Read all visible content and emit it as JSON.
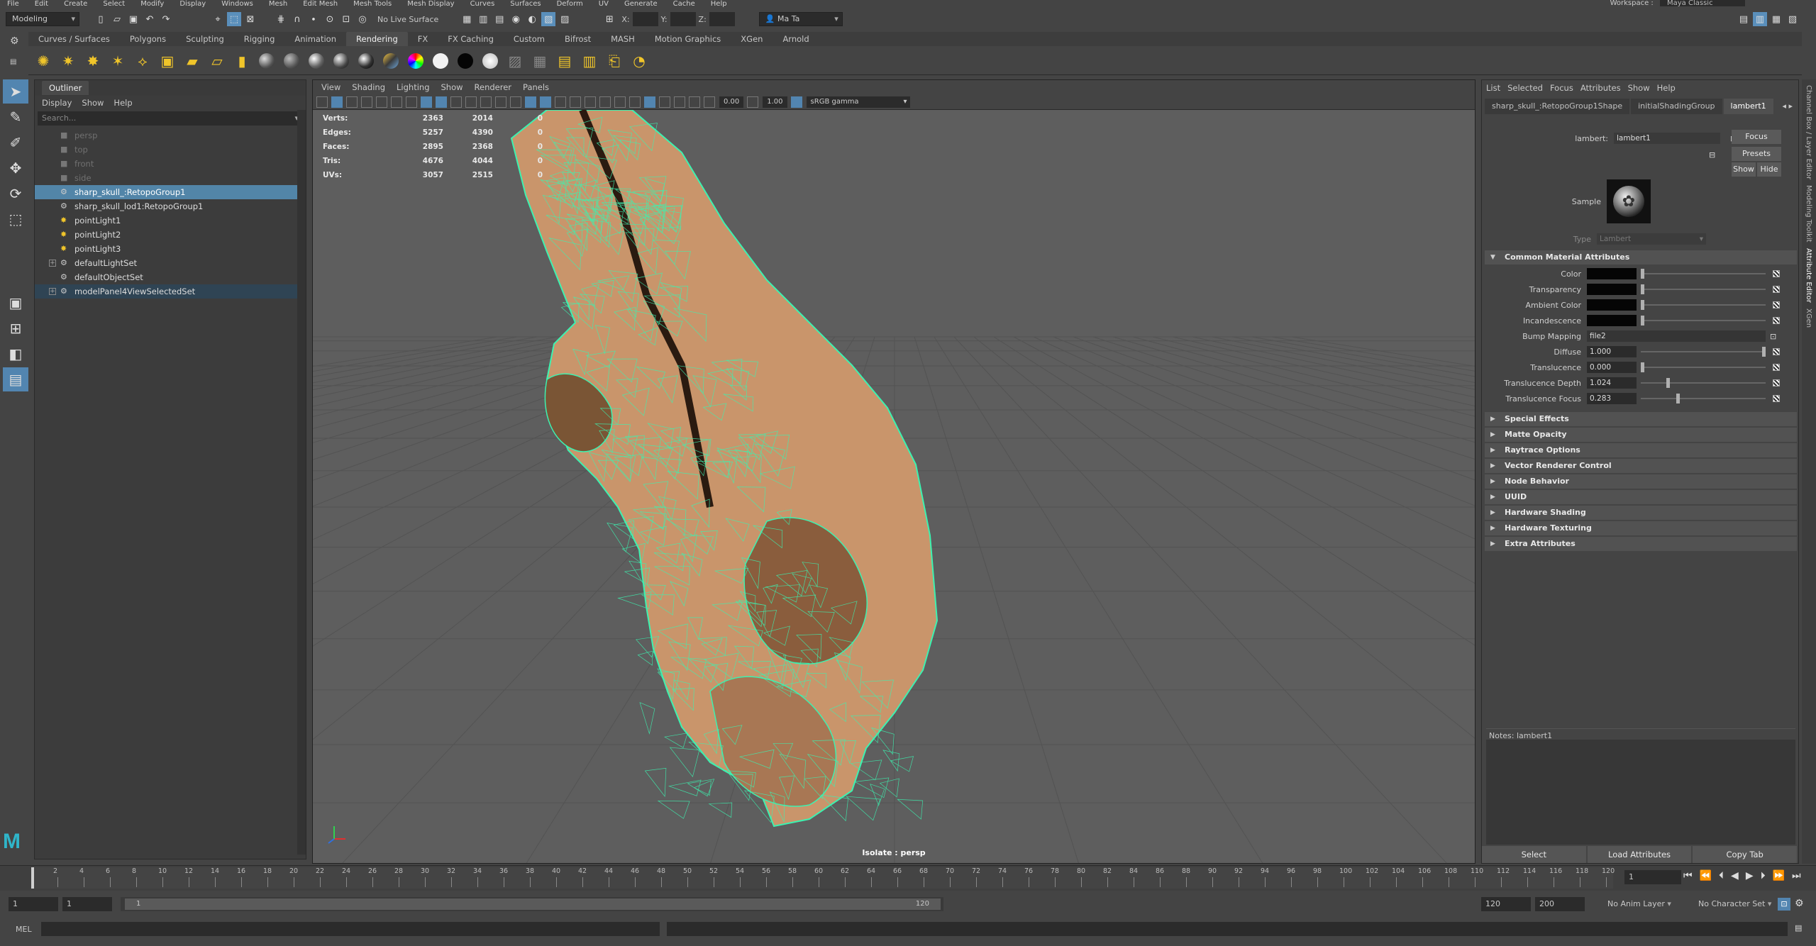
{
  "menubar": [
    "File",
    "Edit",
    "Create",
    "Select",
    "Modify",
    "Display",
    "Windows",
    "Mesh",
    "Edit Mesh",
    "Mesh Tools",
    "Mesh Display",
    "Curves",
    "Surfaces",
    "Deform",
    "UV",
    "Generate",
    "Cache",
    "Help"
  ],
  "workspace": {
    "label": "Workspace :",
    "value": "Maya Classic"
  },
  "status": {
    "mode": "Modeling",
    "live_surface": "No Live Surface",
    "x_label": "X:",
    "y_label": "Y:",
    "z_label": "Z:",
    "user": "Ma Ta"
  },
  "shelf_tabs": [
    "Curves / Surfaces",
    "Polygons",
    "Sculpting",
    "Rigging",
    "Animation",
    "Rendering",
    "FX",
    "FX Caching",
    "Custom",
    "Bifrost",
    "MASH",
    "Motion Graphics",
    "XGen",
    "Arnold"
  ],
  "active_shelf": "Rendering",
  "outliner": {
    "title": "Outliner",
    "menu": [
      "Display",
      "Show",
      "Help"
    ],
    "search_placeholder": "Search...",
    "items": [
      {
        "label": "persp",
        "icon": "camera-icon",
        "dim": true
      },
      {
        "label": "top",
        "icon": "camera-icon",
        "dim": true
      },
      {
        "label": "front",
        "icon": "camera-icon",
        "dim": true
      },
      {
        "label": "side",
        "icon": "camera-icon",
        "dim": true
      },
      {
        "label": "sharp_skull_:RetopoGroup1",
        "icon": "transform-icon",
        "selected": true
      },
      {
        "label": "sharp_skull_lod1:RetopoGroup1",
        "icon": "transform-icon"
      },
      {
        "label": "pointLight1",
        "icon": "point-light-icon"
      },
      {
        "label": "pointLight2",
        "icon": "point-light-icon"
      },
      {
        "label": "pointLight3",
        "icon": "point-light-icon"
      },
      {
        "label": "defaultLightSet",
        "icon": "set-icon",
        "expandable": true
      },
      {
        "label": "defaultObjectSet",
        "icon": "set-icon"
      },
      {
        "label": "modelPanel4ViewSelectedSet",
        "icon": "set-icon",
        "expandable": true,
        "highlight": true
      }
    ]
  },
  "viewport": {
    "menu": [
      "View",
      "Shading",
      "Lighting",
      "Show",
      "Renderer",
      "Panels"
    ],
    "exposure": "0.00",
    "gamma": "1.00",
    "color_space": "sRGB gamma",
    "hud": [
      {
        "label": "Verts:",
        "a": "2363",
        "b": "2014",
        "c": "0"
      },
      {
        "label": "Edges:",
        "a": "5257",
        "b": "4390",
        "c": "0"
      },
      {
        "label": "Faces:",
        "a": "2895",
        "b": "2368",
        "c": "0"
      },
      {
        "label": "Tris:",
        "a": "4676",
        "b": "4044",
        "c": "0"
      },
      {
        "label": "UVs:",
        "a": "3057",
        "b": "2515",
        "c": "0"
      }
    ],
    "isolate": "Isolate : persp"
  },
  "attribute_editor": {
    "menu": [
      "List",
      "Selected",
      "Focus",
      "Attributes",
      "Show",
      "Help"
    ],
    "tabs": [
      "sharp_skull_:RetopoGroup1Shape",
      "initialShadingGroup",
      "lambert1"
    ],
    "node_label": "lambert:",
    "node_name": "lambert1",
    "focus": "Focus",
    "presets": "Presets",
    "show": "Show",
    "hide": "Hide",
    "sample_label": "Sample",
    "type_label": "Type",
    "type_value": "Lambert",
    "common_section": "Common Material Attributes",
    "attrs": {
      "color": "Color",
      "transparency": "Transparency",
      "ambient": "Ambient Color",
      "incandescence": "Incandescence",
      "bump": "Bump Mapping",
      "bump_value": "file2",
      "diffuse": "Diffuse",
      "diffuse_value": "1.000",
      "translucence": "Translucence",
      "translucence_value": "0.000",
      "trans_depth": "Translucence Depth",
      "trans_depth_value": "1.024",
      "trans_focus": "Translucence Focus",
      "trans_focus_value": "0.283"
    },
    "sections": [
      "Special Effects",
      "Matte Opacity",
      "Raytrace Options",
      "Vector Renderer Control",
      "Node Behavior",
      "UUID",
      "Hardware Shading",
      "Hardware Texturing",
      "Extra Attributes"
    ],
    "notes_label": "Notes:",
    "notes_name": "lambert1",
    "buttons": [
      "Select",
      "Load Attributes",
      "Copy Tab"
    ]
  },
  "side_tabs": [
    "Channel Box / Layer Editor",
    "Modeling Toolkit",
    "Attribute Editor",
    "XGen"
  ],
  "timeline": {
    "ticks": [
      "2",
      "4",
      "6",
      "8",
      "10",
      "12",
      "14",
      "16",
      "18",
      "20",
      "22",
      "24",
      "26",
      "28",
      "30",
      "32",
      "34",
      "36",
      "38",
      "40",
      "42",
      "44",
      "46",
      "48",
      "50",
      "52",
      "54",
      "56",
      "58",
      "60",
      "62",
      "64",
      "66",
      "68",
      "70",
      "72",
      "74",
      "76",
      "78",
      "80",
      "82",
      "84",
      "86",
      "88",
      "90",
      "92",
      "94",
      "96",
      "98",
      "100",
      "102",
      "104",
      "106",
      "108",
      "110",
      "112",
      "114",
      "116",
      "118",
      "120"
    ],
    "current_frame": "1",
    "range_start": "1",
    "range_start2": "1",
    "range_field": "1",
    "range_end_marker": "120",
    "end": "120",
    "end2": "200",
    "anim_layer": "No Anim Layer",
    "char_set": "No Character Set"
  },
  "cmdline": {
    "label": "MEL"
  },
  "colors": {
    "accent": "#5285b0",
    "wire": "#3cf2b0",
    "skull": "#c9956b"
  }
}
